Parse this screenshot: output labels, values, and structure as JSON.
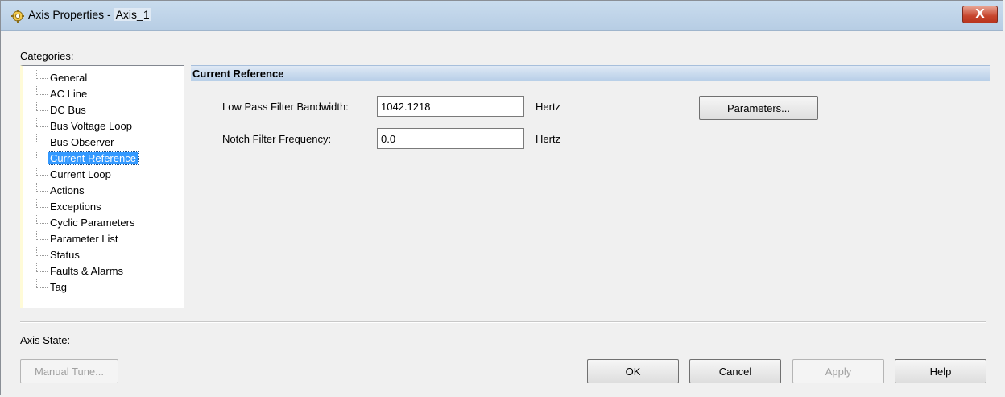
{
  "window": {
    "title_prefix": "Axis Properties - ",
    "axis_name": "Axis_1",
    "close_label": "X"
  },
  "categories": {
    "label": "Categories:",
    "items": [
      {
        "label": "General"
      },
      {
        "label": "AC Line"
      },
      {
        "label": "DC Bus"
      },
      {
        "label": "Bus Voltage Loop"
      },
      {
        "label": "Bus Observer"
      },
      {
        "label": "Current Reference",
        "selected": true
      },
      {
        "label": "Current Loop"
      },
      {
        "label": "Actions"
      },
      {
        "label": "Exceptions"
      },
      {
        "label": "Cyclic Parameters"
      },
      {
        "label": "Parameter List"
      },
      {
        "label": "Status"
      },
      {
        "label": "Faults & Alarms"
      },
      {
        "label": "Tag"
      }
    ]
  },
  "section": {
    "title": "Current Reference",
    "fields": {
      "lpf_label": "Low Pass Filter Bandwidth:",
      "lpf_value": "1042.1218",
      "lpf_unit": "Hertz",
      "notch_label": "Notch Filter Frequency:",
      "notch_value": "0.0",
      "notch_unit": "Hertz"
    },
    "parameters_button": "Parameters..."
  },
  "footer": {
    "axis_state_label": "Axis State:",
    "manual_tune": "Manual Tune...",
    "ok": "OK",
    "cancel": "Cancel",
    "apply": "Apply",
    "help": "Help"
  },
  "colors": {
    "selection": "#3399ff",
    "header_band": "#b8cfe8",
    "close_button": "#c7452d"
  }
}
